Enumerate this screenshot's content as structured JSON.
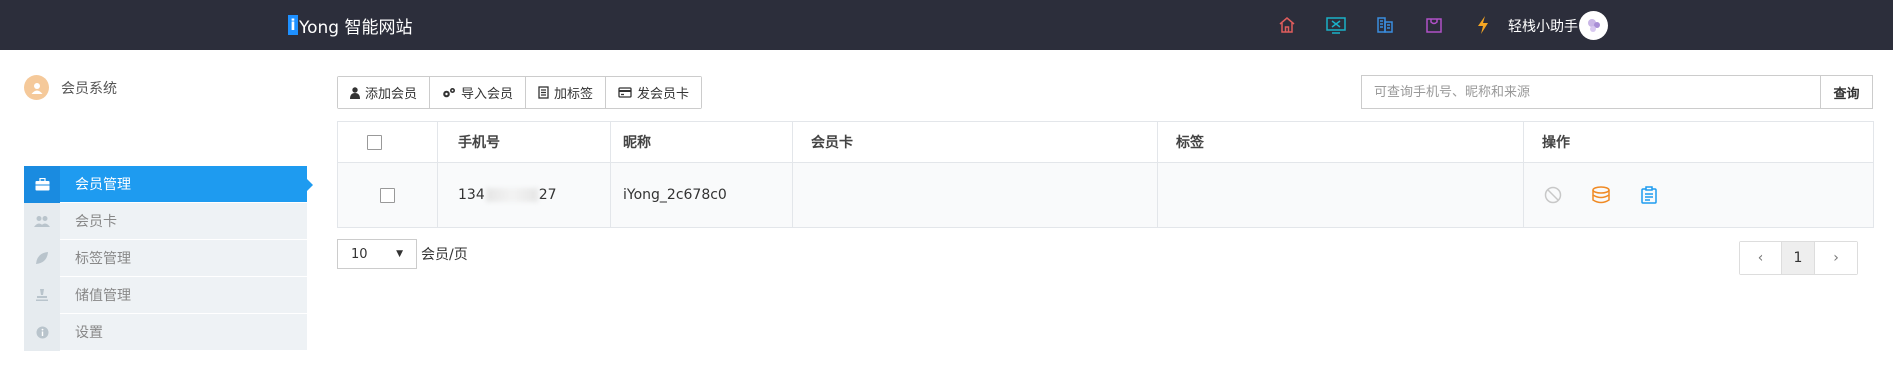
{
  "header": {
    "brand_mark": "i",
    "brand_name": "Yong 智能网站",
    "user_name": "轻栈小助手",
    "icons": [
      "home-icon",
      "monitor-icon",
      "building-icon",
      "bag-icon",
      "lightning-icon"
    ],
    "colors": {
      "bar": "#2c2e3b",
      "home": "#e05d5d",
      "monitor": "#1ab0c8",
      "building": "#3a8de0",
      "bag": "#b050c8",
      "lightning": "#f5a623"
    }
  },
  "sidebar": {
    "system_title": "会员系统",
    "items": [
      {
        "label": "会员管理",
        "icon": "briefcase-icon",
        "active": true
      },
      {
        "label": "会员卡",
        "icon": "users-icon",
        "active": false
      },
      {
        "label": "标签管理",
        "icon": "leaf-icon",
        "active": false
      },
      {
        "label": "储值管理",
        "icon": "stamp-icon",
        "active": false
      },
      {
        "label": "设置",
        "icon": "info-icon",
        "active": false
      }
    ],
    "accent": "#1e9bf0"
  },
  "toolbar": {
    "buttons": [
      {
        "label": "添加会员",
        "icon": "user-icon"
      },
      {
        "label": "导入会员",
        "icon": "gears-icon"
      },
      {
        "label": "加标签",
        "icon": "tag-list-icon"
      },
      {
        "label": "发会员卡",
        "icon": "card-icon"
      }
    ]
  },
  "search": {
    "placeholder": "可查询手机号、昵称和来源",
    "value": "",
    "button_label": "查询"
  },
  "table": {
    "columns": [
      "",
      "手机号",
      "昵称",
      "会员卡",
      "标签",
      "操作"
    ],
    "rows": [
      {
        "phone_prefix": "134",
        "phone_suffix": "27",
        "nickname": "iYong_2c678c0",
        "card": "",
        "tags": "",
        "actions": [
          "disable-icon",
          "coins-icon",
          "clipboard-icon"
        ]
      }
    ]
  },
  "pagination": {
    "page_size": "10",
    "page_size_label": "会员/页",
    "prev": "‹",
    "current_page": "1",
    "next": "›"
  }
}
